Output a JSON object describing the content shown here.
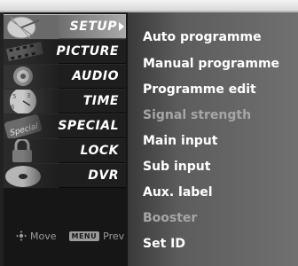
{
  "menu": {
    "items": [
      {
        "label": "SETUP",
        "icon": "satellite-dish-icon",
        "active": true
      },
      {
        "label": "PICTURE",
        "icon": "film-reel-icon",
        "active": false
      },
      {
        "label": "AUDIO",
        "icon": "speaker-icon",
        "active": false
      },
      {
        "label": "TIME",
        "icon": "clock-icon",
        "active": false
      },
      {
        "label": "SPECIAL",
        "icon": "special-tag-icon",
        "active": false
      },
      {
        "label": "LOCK",
        "icon": "padlock-icon",
        "active": false
      },
      {
        "label": "DVR",
        "icon": "disc-icon",
        "active": false
      }
    ]
  },
  "submenu": {
    "items": [
      {
        "label": "Auto programme",
        "enabled": true
      },
      {
        "label": "Manual programme",
        "enabled": true
      },
      {
        "label": "Programme edit",
        "enabled": true
      },
      {
        "label": "Signal strength",
        "enabled": false
      },
      {
        "label": "Main input",
        "enabled": true
      },
      {
        "label": "Sub input",
        "enabled": true
      },
      {
        "label": "Aux. label",
        "enabled": true
      },
      {
        "label": "Booster",
        "enabled": false
      },
      {
        "label": "Set ID",
        "enabled": true
      }
    ]
  },
  "hints": {
    "move_label": "Move",
    "menu_key_label": "MENU",
    "prev_label": "Prev"
  },
  "colors": {
    "text_enabled": "#ffffff",
    "text_disabled": "#a6a6a6",
    "highlight": "#a9a9a9"
  }
}
